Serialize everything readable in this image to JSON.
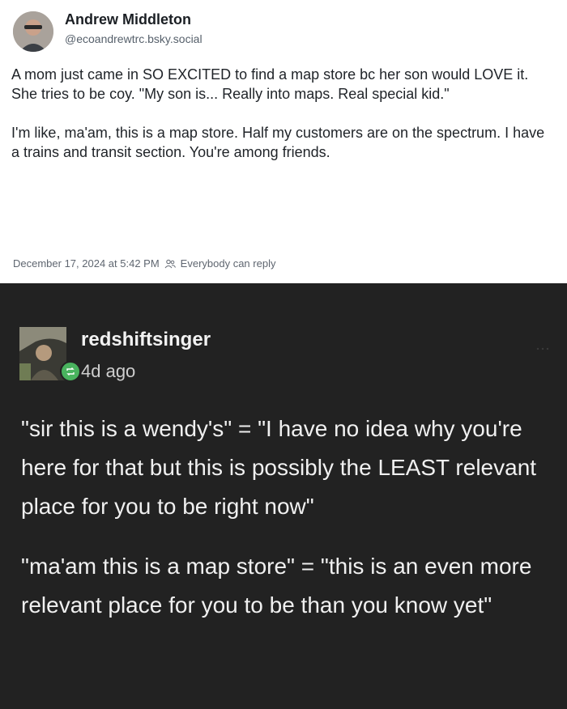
{
  "post": {
    "author": "Andrew Middleton",
    "handle": "@ecoandrewtrc.bsky.social",
    "paragraphs": [
      "A mom just came in SO EXCITED to find a map store bc her son would LOVE it.",
      "She tries to be coy. \"My son is... Really into maps. Real special kid.\"",
      "",
      "I'm like, ma'am, this is a map store. Half my customers are on the spectrum. I have a trains and transit section. You're among friends."
    ],
    "timestamp": "December 17, 2024 at 5:42 PM",
    "reply_setting": "Everybody can reply",
    "reply_icon": "people-icon"
  },
  "reblog": {
    "username": "redshiftsinger",
    "time": "4d ago",
    "badge_icon": "reblog-icon",
    "paragraphs": [
      "\"sir this is a wendy's\" = \"I have no idea why you're here for that but this is possibly the LEAST relevant place for you to be right now\"",
      "\"ma'am this is a map store\" = \"this is an even more relevant place for you to be than you know yet\""
    ]
  },
  "colors": {
    "top_bg": "#ffffff",
    "bottom_bg": "#222222",
    "badge": "#49b35e"
  }
}
